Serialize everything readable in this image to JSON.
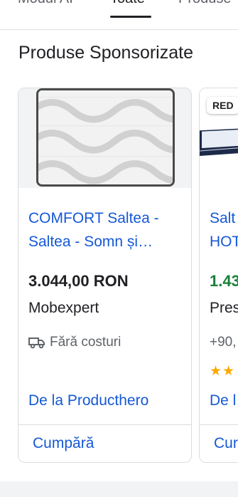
{
  "tabs": [
    {
      "label": "Modul AI"
    },
    {
      "label": "Toate",
      "selected": true
    },
    {
      "label": "Produse"
    }
  ],
  "section_title": "Produse Sponsorizate",
  "products": [
    {
      "title_line1": "COMFORT Saltea -",
      "title_line2": "Saltea - Somn și…",
      "price": "3.044,00 RON",
      "seller": "Mobexpert",
      "shipping": "Fără costuri",
      "from": "De la Producthero",
      "buy": "Cumpără"
    },
    {
      "badge": "RED",
      "title_line1": "Salt",
      "title_line2": "HOT",
      "price": "1.43",
      "seller": "Pres",
      "shipping": "+90,",
      "rating_stars": "★★",
      "from": "De l",
      "buy": "Cur"
    }
  ],
  "colors": {
    "link": "#1558d6",
    "price_sale": "#188038",
    "star": "#f9ab00"
  }
}
